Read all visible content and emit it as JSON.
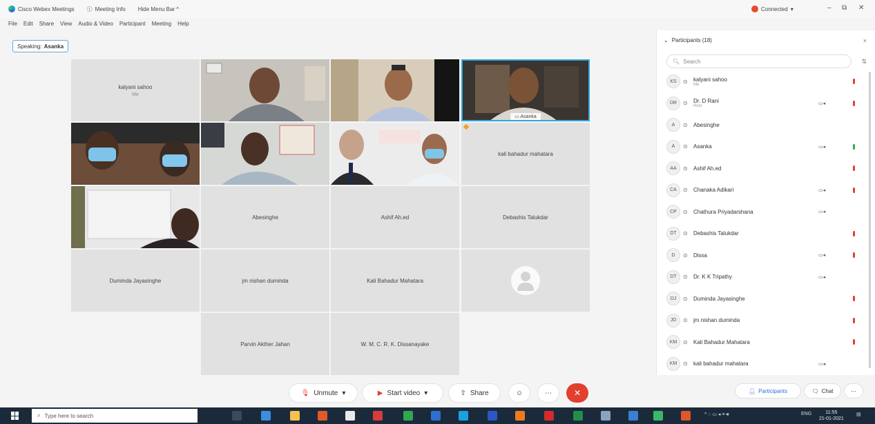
{
  "titlebar": {
    "app_name": "Cisco Webex Meetings",
    "meeting_info": "Meeting Info",
    "hide_menu": "Hide Menu Bar ^",
    "connection": "Connected",
    "minimize": "–",
    "maximize": "⧉",
    "close": "✕"
  },
  "menu": [
    "File",
    "Edit",
    "Share",
    "View",
    "Audio & Video",
    "Participant",
    "Meeting",
    "Help"
  ],
  "speaking": {
    "label": "Speaking:",
    "name": "Asanka"
  },
  "grid": {
    "kalyani": {
      "name": "kalyani sahoo",
      "sub": "Me"
    },
    "asanka_tag": "Asanka",
    "kali_lower": "kali bahadur mahatara",
    "abesinghe": "Abesinghe",
    "ashif": "Ashif Ah.ed",
    "debashis": "Debashis Talukdar",
    "duminda": "Duminda Jayasinghe",
    "jm": "jm nishan duminda",
    "kali_upper": "Kali Bahadur Mahatara",
    "parvin": "Parvin Akther Jahan",
    "wmc": "W. M. C. R. K. Dissanayake"
  },
  "controls": {
    "unmute": "Unmute",
    "start_video": "Start video",
    "share": "Share",
    "leave": "✕"
  },
  "panel": {
    "title": "Participants (18)",
    "search_placeholder": "Search",
    "participants": [
      {
        "initials": "KS",
        "name": "kalyani sahoo",
        "sub": "Me",
        "cam": false,
        "mic": "#e2402f"
      },
      {
        "initials": "DR",
        "name": "Dr. D Rani",
        "sub": "Host",
        "cam": true,
        "mic": "#e2402f"
      },
      {
        "initials": "A",
        "name": "Abesinghe",
        "sub": "",
        "cam": false,
        "mic": ""
      },
      {
        "initials": "A",
        "name": "Asanka",
        "sub": "",
        "cam": true,
        "mic": "#3aa64a"
      },
      {
        "initials": "AA",
        "name": "Ashif Ah.ed",
        "sub": "",
        "cam": false,
        "mic": "#e2402f"
      },
      {
        "initials": "CA",
        "name": "Chanaka Adikari",
        "sub": "",
        "cam": true,
        "mic": "#e2402f"
      },
      {
        "initials": "CP",
        "name": "Chathura Priyadarshana",
        "sub": "",
        "cam": true,
        "mic": ""
      },
      {
        "initials": "DT",
        "name": "Debashis Talukdar",
        "sub": "",
        "cam": false,
        "mic": "#e2402f"
      },
      {
        "initials": "D",
        "name": "Dissa",
        "sub": "",
        "cam": true,
        "mic": "#e2402f"
      },
      {
        "initials": "DT",
        "name": "Dr. K K Tripathy",
        "sub": "",
        "cam": true,
        "mic": ""
      },
      {
        "initials": "DJ",
        "name": "Duminda Jayasinghe",
        "sub": "",
        "cam": false,
        "mic": "#e2402f"
      },
      {
        "initials": "JD",
        "name": "jm nishan duminda",
        "sub": "",
        "cam": false,
        "mic": "#e2402f"
      },
      {
        "initials": "KM",
        "name": "Kali Bahadur Mahatara",
        "sub": "",
        "cam": false,
        "mic": "#e2402f"
      },
      {
        "initials": "KM",
        "name": "kali bahadur mahatara",
        "sub": "",
        "cam": true,
        "mic": ""
      }
    ],
    "participants_btn": "Participants",
    "chat_btn": "Chat"
  },
  "taskbar": {
    "search_placeholder": "Type here to search",
    "tray_lang": "ENG",
    "time": "11:55",
    "date": "21-01-2021"
  }
}
